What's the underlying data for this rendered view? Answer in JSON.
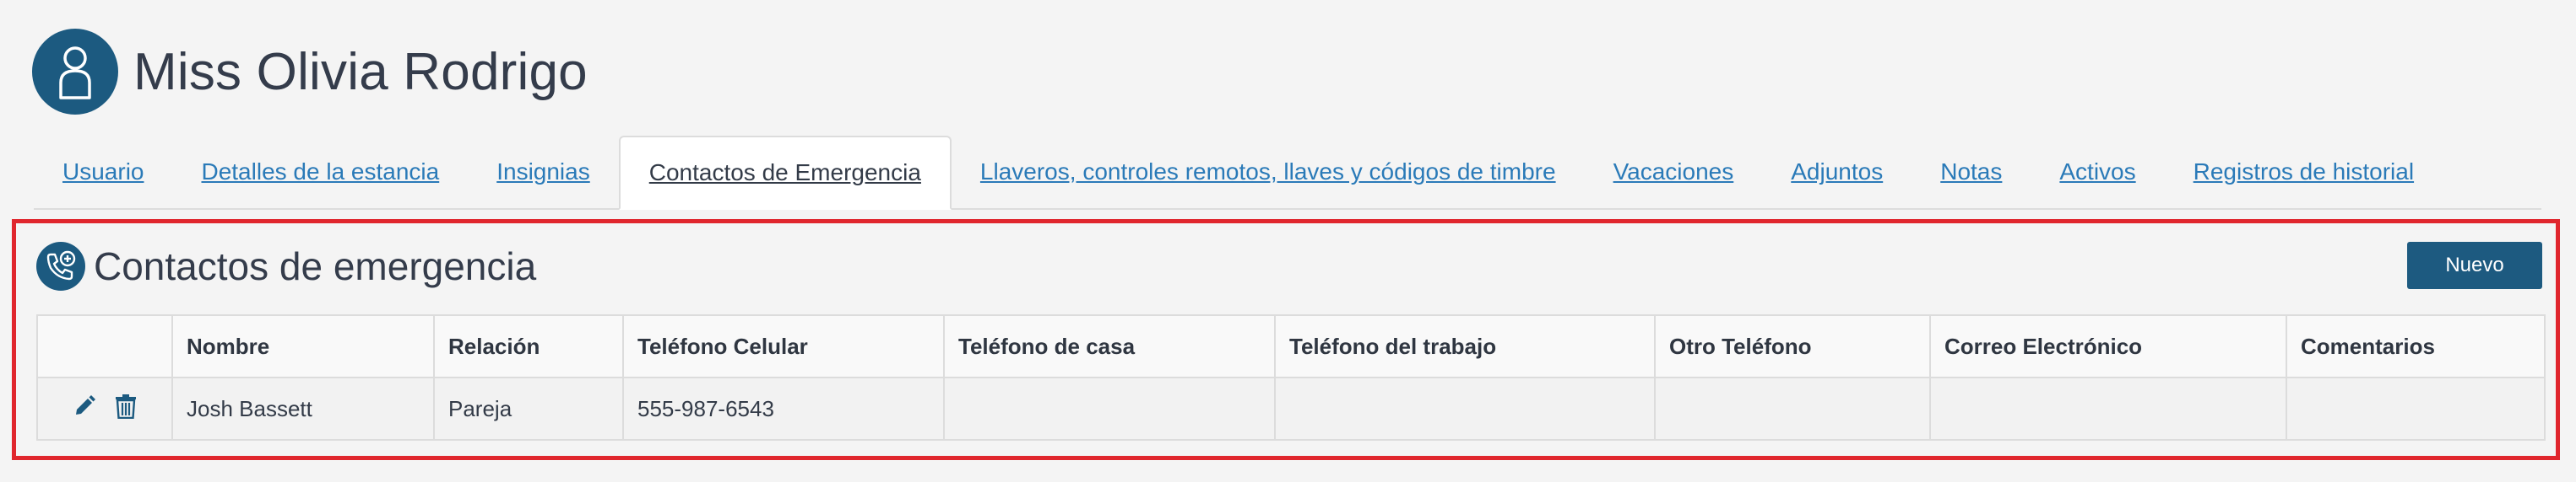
{
  "header": {
    "title": "Miss Olivia Rodrigo",
    "avatar_icon": "user-icon"
  },
  "tabs": [
    {
      "label": "Usuario",
      "active": false
    },
    {
      "label": "Detalles de la estancia",
      "active": false
    },
    {
      "label": "Insignias",
      "active": false
    },
    {
      "label": "Contactos de Emergencia",
      "active": true
    },
    {
      "label": "Llaveros, controles remotos, llaves y códigos de timbre",
      "active": false
    },
    {
      "label": "Vacaciones",
      "active": false
    },
    {
      "label": "Adjuntos",
      "active": false
    },
    {
      "label": "Notas",
      "active": false
    },
    {
      "label": "Activos",
      "active": false
    },
    {
      "label": "Registros de historial",
      "active": false
    }
  ],
  "section": {
    "title": "Contactos de emergencia",
    "icon": "emergency-phone-icon",
    "new_button_label": "Nuevo"
  },
  "table": {
    "columns": [
      "",
      "Nombre",
      "Relación",
      "Teléfono Celular",
      "Teléfono de casa",
      "Teléfono del trabajo",
      "Otro Teléfono",
      "Correo Electrónico",
      "Comentarios"
    ],
    "rows": [
      {
        "nombre": "Josh Bassett",
        "relacion": "Pareja",
        "telefono_celular": "555-987-6543",
        "telefono_casa": "",
        "telefono_trabajo": "",
        "otro_telefono": "",
        "correo": "",
        "comentarios": ""
      }
    ]
  },
  "colors": {
    "accent": "#1c5a80",
    "link": "#2a7ab8",
    "highlight_border": "#e0262d"
  }
}
